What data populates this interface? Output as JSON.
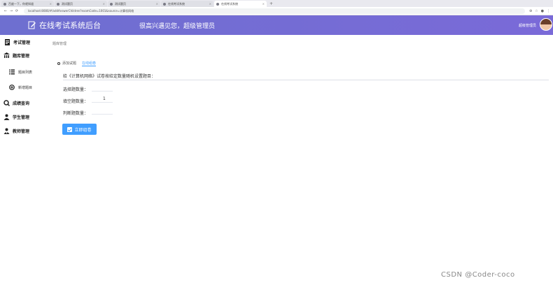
{
  "browser": {
    "tabs": [
      {
        "label": "百度一下，你就知道",
        "active": false
      },
      {
        "label": "测试题页",
        "active": false
      },
      {
        "label": "测试题页",
        "active": false
      },
      {
        "label": "在线考试系统",
        "active": false
      },
      {
        "label": "在线考试系统",
        "active": true
      }
    ],
    "new_tab": "+",
    "url": "localhost:8080/#/addAnswerChildren?examCode=1001&source=计算机网络"
  },
  "header": {
    "brand": "在线考试系统后台",
    "welcome": "很高兴遇见您，超级管理员",
    "user": "超级管理员"
  },
  "sidebar": {
    "items": [
      {
        "label": "考试管理",
        "icon": "exam-icon"
      },
      {
        "label": "题库管理",
        "icon": "bank-icon"
      },
      {
        "label": "题目列表",
        "icon": "list-icon"
      },
      {
        "label": "新增题目",
        "icon": "add-icon"
      },
      {
        "label": "成绩查询",
        "icon": "search-icon"
      },
      {
        "label": "学生管理",
        "icon": "student-icon"
      },
      {
        "label": "教师管理",
        "icon": "teacher-icon"
      }
    ]
  },
  "main": {
    "breadcrumb": "题库管理",
    "tabs": [
      {
        "label": "添加试题"
      },
      {
        "label": "在线组卷",
        "active": true
      }
    ],
    "prompt": "给《计算机网络》试卷按给定数量随机设置题目：",
    "fields": [
      {
        "label": "选择题数量：",
        "value": ""
      },
      {
        "label": "填空题数量：",
        "value": "1"
      },
      {
        "label": "判断题数量：",
        "value": ""
      }
    ],
    "create_button": "立即组卷"
  },
  "watermark": "CSDN @Coder-coco",
  "colors": {
    "header": "#7070d4",
    "accent": "#409eff"
  }
}
